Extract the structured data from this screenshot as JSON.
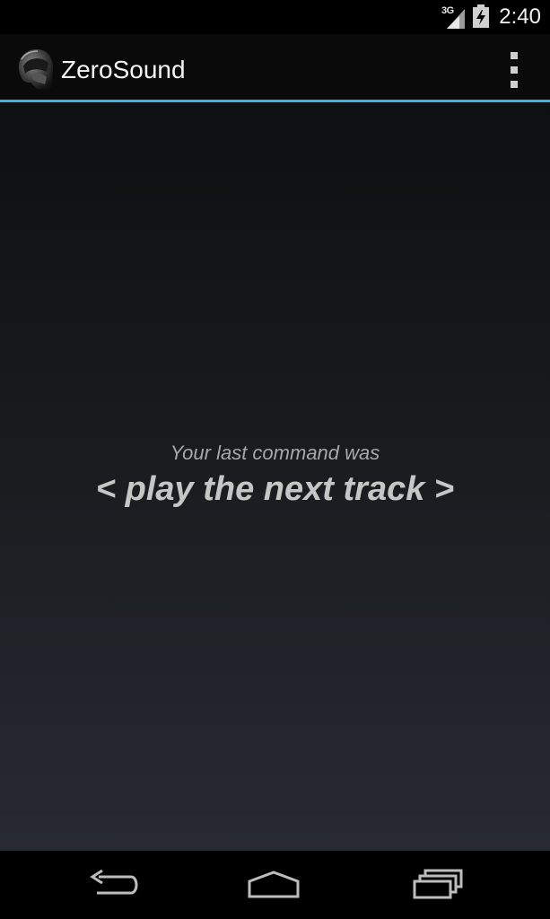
{
  "status_bar": {
    "network_type": "3G",
    "time": "2:40",
    "icons": [
      "signal-icon",
      "battery-charging-icon"
    ]
  },
  "action_bar": {
    "title": "ZeroSound",
    "app_icon": "helmet-icon",
    "overflow_icon": "overflow-menu-icon",
    "accent_color": "#33b5e5"
  },
  "main": {
    "caption": "Your last command was",
    "command": "< play the next track >"
  },
  "nav_bar": {
    "icons": [
      "back-icon",
      "home-icon",
      "recents-icon"
    ]
  }
}
